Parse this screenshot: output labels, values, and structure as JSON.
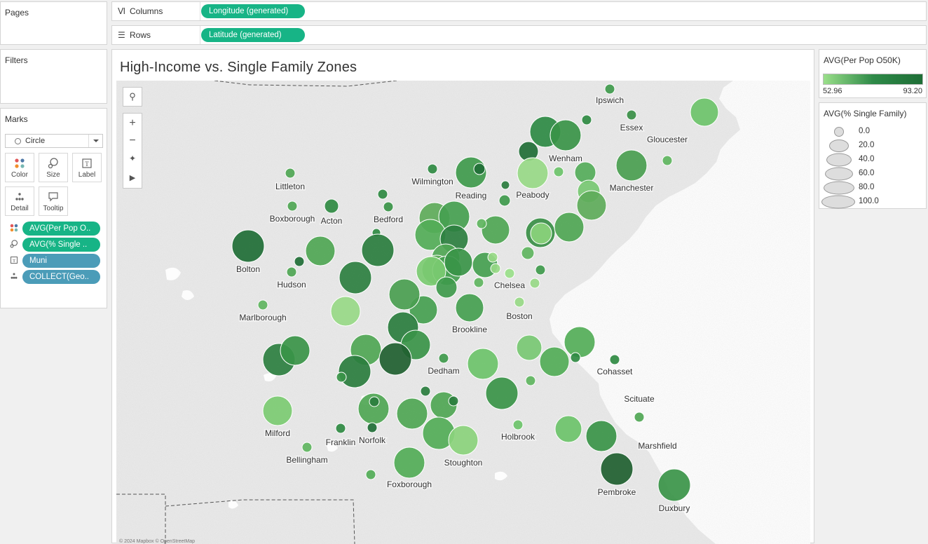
{
  "sidebar": {
    "pages_title": "Pages",
    "filters_title": "Filters",
    "marks_title": "Marks",
    "mark_type": "Circle",
    "buttons": [
      {
        "label": "Color",
        "icon": "color-dots-icon"
      },
      {
        "label": "Size",
        "icon": "size-icon"
      },
      {
        "label": "Label",
        "icon": "label-icon"
      },
      {
        "label": "Detail",
        "icon": "detail-icon"
      },
      {
        "label": "Tooltip",
        "icon": "tooltip-icon"
      }
    ],
    "pills": [
      {
        "label": "AVG(Per Pop O..",
        "icon": "color-dots-icon",
        "color": "#17b486"
      },
      {
        "label": "AVG(% Single ..",
        "icon": "size-icon",
        "color": "#17b486"
      },
      {
        "label": "Muni",
        "icon": "label-icon",
        "color": "#4b9cb8"
      },
      {
        "label": "COLLECT(Geo..",
        "icon": "detail-icon",
        "color": "#4b9cb8"
      }
    ]
  },
  "shelves": {
    "columns_label": "Columns",
    "columns_pill": "Longitude (generated)",
    "rows_label": "Rows",
    "rows_pill": "Latitude (generated)"
  },
  "view": {
    "title": "High-Income vs. Single Family Zones",
    "attribution": "© 2024 Mapbox © OpenStreetMap"
  },
  "legend_color": {
    "title": "AVG(Per Pop O50K)",
    "min": "52.96",
    "max": "93.20",
    "colors": [
      "#9adf8a",
      "#1e6e36"
    ]
  },
  "legend_size": {
    "title": "AVG(% Single Family)",
    "items": [
      "0.0",
      "20.0",
      "40.0",
      "60.0",
      "80.0",
      "100.0"
    ]
  },
  "map": {
    "labels": [
      {
        "t": "Ipswich"
      },
      {
        "t": "Essex"
      },
      {
        "t": "Gloucester"
      },
      {
        "t": "Wenham"
      },
      {
        "t": "Manchester"
      },
      {
        "t": "Peabody"
      },
      {
        "t": "Reading"
      },
      {
        "t": "Wilmington"
      },
      {
        "t": "Littleton"
      },
      {
        "t": "Boxborough"
      },
      {
        "t": "Acton"
      },
      {
        "t": "Bedford"
      },
      {
        "t": "Bolton"
      },
      {
        "t": "Hudson"
      },
      {
        "t": "Chelsea"
      },
      {
        "t": "Marlborough"
      },
      {
        "t": "Boston"
      },
      {
        "t": "Brookline"
      },
      {
        "t": "Dedham"
      },
      {
        "t": "Cohasset"
      },
      {
        "t": "Scituate"
      },
      {
        "t": "Milford"
      },
      {
        "t": "Franklin"
      },
      {
        "t": "Norfolk"
      },
      {
        "t": "Holbrook"
      },
      {
        "t": "Marshfield"
      },
      {
        "t": "Bellingham"
      },
      {
        "t": "Stoughton"
      },
      {
        "t": "Pembroke"
      },
      {
        "t": "Foxborough"
      },
      {
        "t": "Duxbury"
      }
    ]
  }
}
